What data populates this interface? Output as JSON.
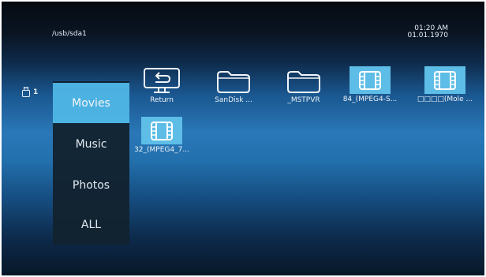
{
  "header": {
    "path": "/usb/sda1",
    "time": "01:20 AM",
    "date": "01.01.1970"
  },
  "device": {
    "icon": "usb-drive-icon",
    "count": "1"
  },
  "sidebar": {
    "items": [
      {
        "label": "Movies",
        "active": true
      },
      {
        "label": "Music",
        "active": false
      },
      {
        "label": "Photos",
        "active": false
      },
      {
        "label": "ALL",
        "active": false
      }
    ]
  },
  "files": {
    "items": [
      {
        "label": "Return",
        "icon": "return-icon"
      },
      {
        "label": "SanDisk ...",
        "icon": "folder-icon"
      },
      {
        "label": "_MSTPVR",
        "icon": "folder-icon"
      },
      {
        "label": "84_(MPEG4-S...",
        "icon": "video-file-icon"
      },
      {
        "label": "□□□□(Mole ...",
        "icon": "video-file-icon"
      },
      {
        "label": "32_(MPEG4_7...",
        "icon": "video-file-icon"
      }
    ]
  },
  "colors": {
    "accent": "#4fb7e6",
    "sidebar_bg": "#12222f"
  }
}
